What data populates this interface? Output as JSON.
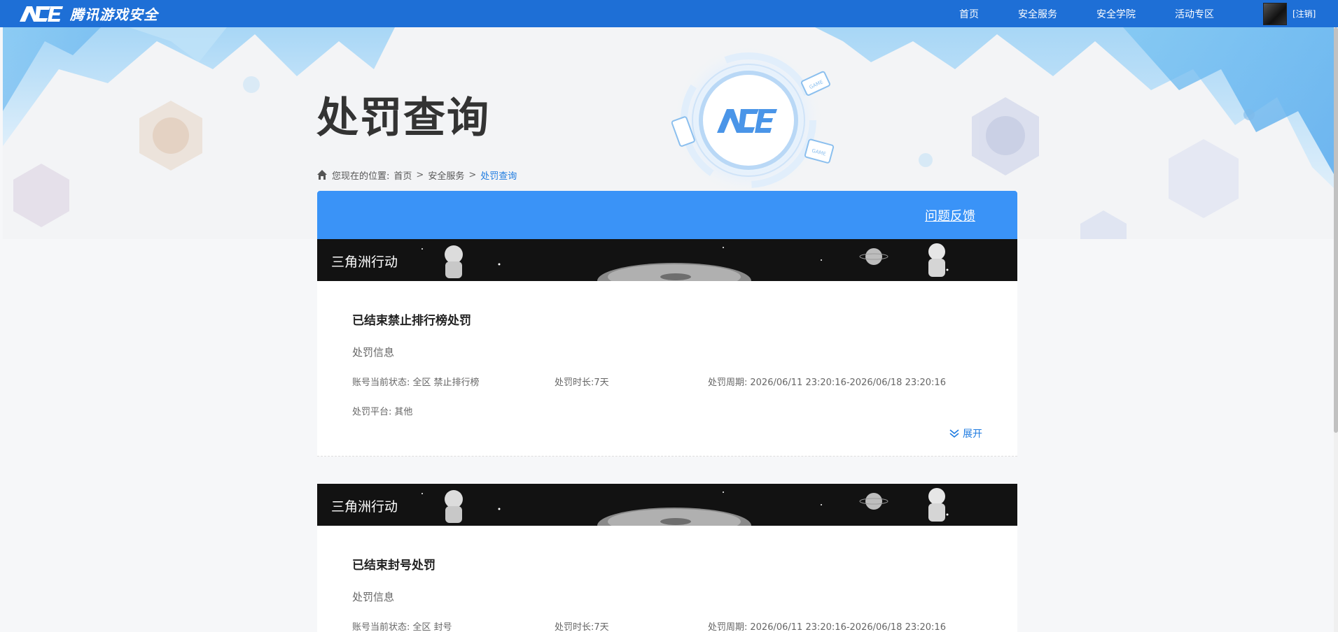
{
  "brand": {
    "logo_text": "ACE",
    "name": "腾讯游戏安全"
  },
  "nav": {
    "items": [
      "首页",
      "安全服务",
      "安全学院",
      "活动专区"
    ],
    "logout": "[注销]"
  },
  "page": {
    "title": "处罚查询",
    "breadcrumb": {
      "prefix": "您现在的位置:",
      "items": [
        "首页",
        "安全服务"
      ],
      "current": "处罚查询",
      "sep": ">"
    },
    "feedback": "问题反馈"
  },
  "records": [
    {
      "game": "三角洲行动",
      "title": "已结束禁止排行榜处罚",
      "section": "处罚信息",
      "status_label": "账号当前状态:",
      "status_value": "全区 禁止排行榜",
      "duration_label": "处罚时长:",
      "duration_value": "7天",
      "period_label": "处罚周期:",
      "period_value": "2026/06/11 23:20:16-2026/06/18 23:20:16",
      "platform_label": "处罚平台:",
      "platform_value": "其他",
      "expand": "展开"
    },
    {
      "game": "三角洲行动",
      "title": "已结束封号处罚",
      "section": "处罚信息",
      "status_label": "账号当前状态:",
      "status_value": "全区 封号",
      "duration_label": "处罚时长:",
      "duration_value": "7天",
      "period_label": "处罚周期:",
      "period_value": "2026/06/11 23:20:16-2026/06/18 23:20:16"
    }
  ],
  "hero_badges": [
    "GAME",
    "GAME",
    "GAME"
  ],
  "colors": {
    "topbar": "#1e6fd6",
    "panel_header": "#3a93f7",
    "link_active": "#1e7be0"
  }
}
